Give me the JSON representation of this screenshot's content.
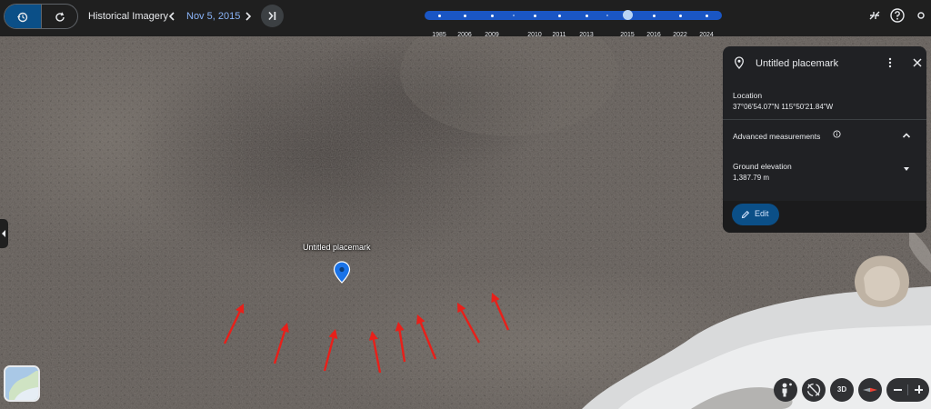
{
  "toolbar": {
    "historical_imagery_label": "Historical Imagery",
    "date": "Nov 5, 2015",
    "timeline_years": [
      "1985",
      "2006",
      "2009",
      "2010",
      "2011",
      "2013",
      "2015",
      "2016",
      "2022",
      "2024"
    ],
    "selected_year": "2015"
  },
  "panel": {
    "title": "Untitled placemark",
    "location_label": "Location",
    "location_value": "37°06'54.07\"N 115°50'21.84\"W",
    "advanced_label": "Advanced measurements",
    "elevation_label": "Ground elevation",
    "elevation_value": "1,387.79 m",
    "edit_label": "Edit"
  },
  "map": {
    "placemark_label": "Untitled placemark",
    "annotation_arrow_color": "#e8201a",
    "annotation_arrow_count": 9
  },
  "controls": {
    "three_d_label": "3D"
  },
  "colors": {
    "accent": "#0b4f87",
    "timeline": "#1a56c4",
    "panel_bg": "#202124",
    "pin": "#1a73e8"
  }
}
